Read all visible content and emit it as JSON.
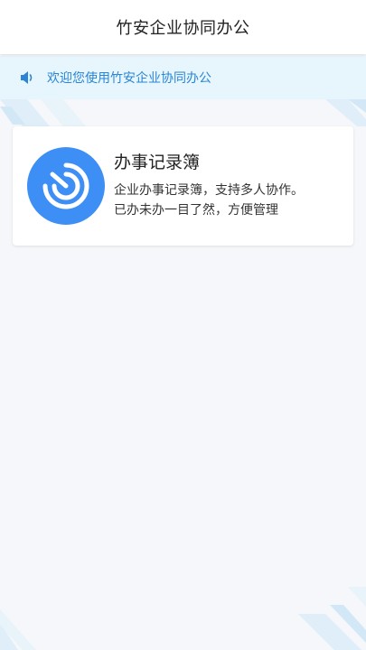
{
  "header": {
    "title": "竹安企业协同办公"
  },
  "notice": {
    "icon": "speaker-icon",
    "text": "欢迎您使用竹安企业协同办公"
  },
  "apps": [
    {
      "icon": "record-book-logo-icon",
      "title": "办事记录簿",
      "desc_line1": "企业办事记录簿，支持多人协作。",
      "desc_line2": "已办未办一目了然，方便管理"
    }
  ],
  "colors": {
    "accent": "#2a86d4",
    "logo_bg": "#3d8ef5",
    "notice_bg": "#e7f5fd",
    "page_bg": "#f5f7fa"
  }
}
